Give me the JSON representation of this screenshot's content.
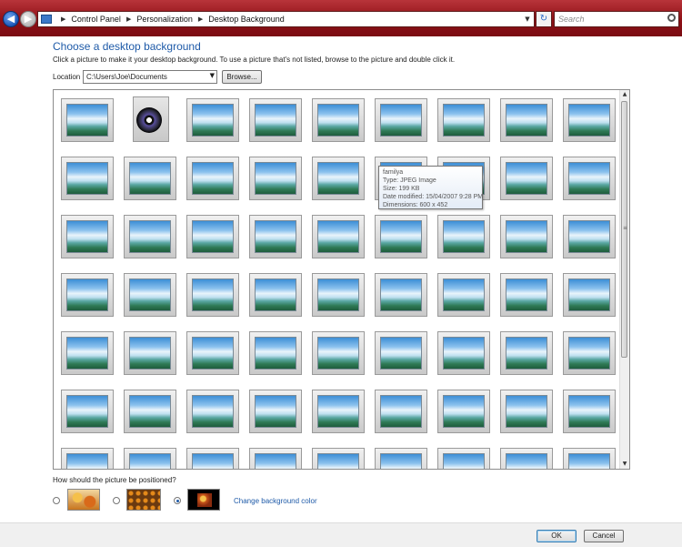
{
  "address_bar": {
    "breadcrumbs": [
      "Control Panel",
      "Personalization",
      "Desktop Background"
    ],
    "search_placeholder": "Search"
  },
  "page": {
    "heading": "Choose a desktop background",
    "instructions": "Click a picture to make it your desktop background. To use a picture that's not listed, browse to the picture and double click it.",
    "location_label": "Location",
    "location_value": "C:\\Users\\Joe\\Documents",
    "browse_label": "Browse..."
  },
  "gallery": {
    "tooltip": {
      "name": "familya",
      "type": "Type: JPEG Image",
      "size": "Size: 199 KB",
      "date_modified": "Date modified: 15/04/2007 9:28 PM",
      "dimensions": "Dimensions: 600 x 452"
    }
  },
  "position": {
    "question": "How should the picture be positioned?",
    "options": [
      "fill",
      "tile",
      "center"
    ],
    "selected": "center",
    "change_color_label": "Change background color"
  },
  "buttons": {
    "ok": "OK",
    "cancel": "Cancel"
  },
  "colors": {
    "title_bar": "#8e1016",
    "link": "#1e5aa8"
  }
}
